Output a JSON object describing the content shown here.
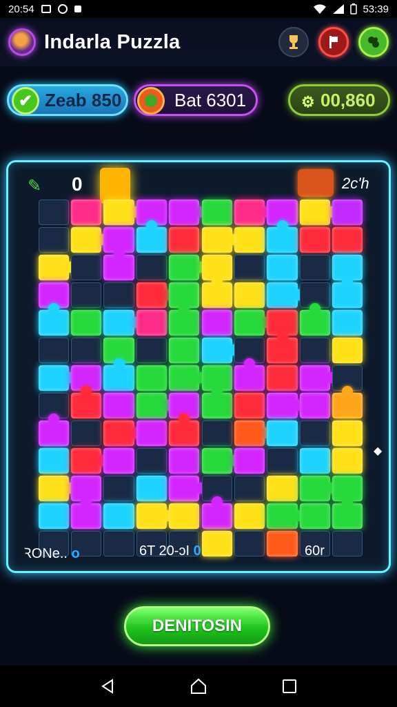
{
  "status_bar": {
    "time_left": "20:54",
    "time_right": "53:39"
  },
  "app": {
    "title": "Indarla Puzzla"
  },
  "stats": {
    "score_label": "Zeab 850",
    "best_label": "Bat 6301",
    "coins_label": "00,860"
  },
  "board": {
    "top_left_count": "0",
    "top_right_label": "2c'h",
    "bottom_left_label": "ꝚONe..",
    "bottom_left_mark": "o",
    "bottom_center_label": "6T 20-ɔI",
    "bottom_center_mark": "0",
    "bottom_right_label": "60r",
    "tile_colors": [
      [
        "#1a2a44",
        "#ff2b8a",
        "#ffe11a",
        "#d326ff",
        "#d326ff",
        "#27d93c",
        "#ff2b8a",
        "#d326ff",
        "#ffe11a",
        "#c22bff"
      ],
      [
        "#1a2a44",
        "#ffe11a",
        "#d326ff",
        "#1fd3ff",
        "#ff2b3a",
        "#ffe11a",
        "#ffe11a",
        "#1fd3ff",
        "#ff2b3a",
        "#ff2b3a"
      ],
      [
        "#ffe11a",
        "#1a2a44",
        "#d326ff",
        "#1a2a44",
        "#27d93c",
        "#ffe11a",
        "#1a2a44",
        "#1fd3ff",
        "#1a2a44",
        "#1fd3ff"
      ],
      [
        "#d326ff",
        "#1a2a44",
        "#1a2a44",
        "#ff2b3a",
        "#27d93c",
        "#ffe11a",
        "#ffe11a",
        "#1fd3ff",
        "#1a2a44",
        "#1fd3ff"
      ],
      [
        "#1fd3ff",
        "#27d93c",
        "#1fd3ff",
        "#ff2b8a",
        "#27d93c",
        "#d326ff",
        "#27d93c",
        "#ff2b3a",
        "#27d93c",
        "#1fd3ff"
      ],
      [
        "#1a2a44",
        "#1a2a44",
        "#27d93c",
        "#1a2a44",
        "#27d93c",
        "#1fd3ff",
        "#1a2a44",
        "#ff2b3a",
        "#1a2a44",
        "#ffe11a"
      ],
      [
        "#1fd3ff",
        "#d326ff",
        "#1fd3ff",
        "#27d93c",
        "#27d93c",
        "#27d93c",
        "#d326ff",
        "#ff2b3a",
        "#d326ff",
        "#1a2a44"
      ],
      [
        "#1a2a44",
        "#ff2b3a",
        "#d326ff",
        "#27d93c",
        "#d326ff",
        "#27d93c",
        "#ff2b3a",
        "#d326ff",
        "#d326ff",
        "#ffa51a"
      ],
      [
        "#d326ff",
        "#1a2a44",
        "#ff2b3a",
        "#d326ff",
        "#ff2b3a",
        "#1a2a44",
        "#ff5a1a",
        "#1fd3ff",
        "#1a2a44",
        "#ffe11a"
      ],
      [
        "#1fd3ff",
        "#ff2b3a",
        "#d326ff",
        "#1a2a44",
        "#d326ff",
        "#27d93c",
        "#d326ff",
        "#1a2a44",
        "#1fd3ff",
        "#ffe11a"
      ],
      [
        "#ffe11a",
        "#d326ff",
        "#1a2a44",
        "#1fd3ff",
        "#d326ff",
        "#1a2a44",
        "#1a2a44",
        "#ffe11a",
        "#27d93c",
        "#27d93c"
      ],
      [
        "#1fd3ff",
        "#d326ff",
        "#1fd3ff",
        "#ffe11a",
        "#ffe11a",
        "#d326ff",
        "#ffe11a",
        "#27d93c",
        "#27d93c",
        "#27d93c"
      ],
      [
        "#1a2a44",
        "#1a2a44",
        "#1a2a44",
        "#1a2a44",
        "#1a2a44",
        "#ffe11a",
        "#1a2a44",
        "#ff5a1a",
        "#1a2a44",
        "#1a2a44"
      ]
    ]
  },
  "action_button": {
    "label": "DENITOSIN"
  },
  "colors": {
    "board_border": "#6ef0ff",
    "accent_green": "#27d93c",
    "accent_purple": "#c552ee"
  }
}
